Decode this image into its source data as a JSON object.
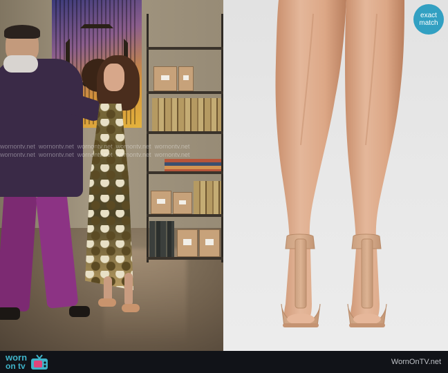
{
  "scene": {
    "watermark_text": "wornontv.net"
  },
  "badge": {
    "line1": "exact",
    "line2": "match"
  },
  "footer": {
    "logo_line1": "worn",
    "logo_line2": "on tv",
    "site": "WornOnTV.net"
  },
  "colors": {
    "badge": "#32a0c2",
    "logo": "#3fb3c9",
    "bar": "#111318",
    "shoe": "#d9a987",
    "leg": "#d8a988"
  },
  "icons": {
    "tv": "tv-icon",
    "ribbon": "ribbon-icon"
  }
}
